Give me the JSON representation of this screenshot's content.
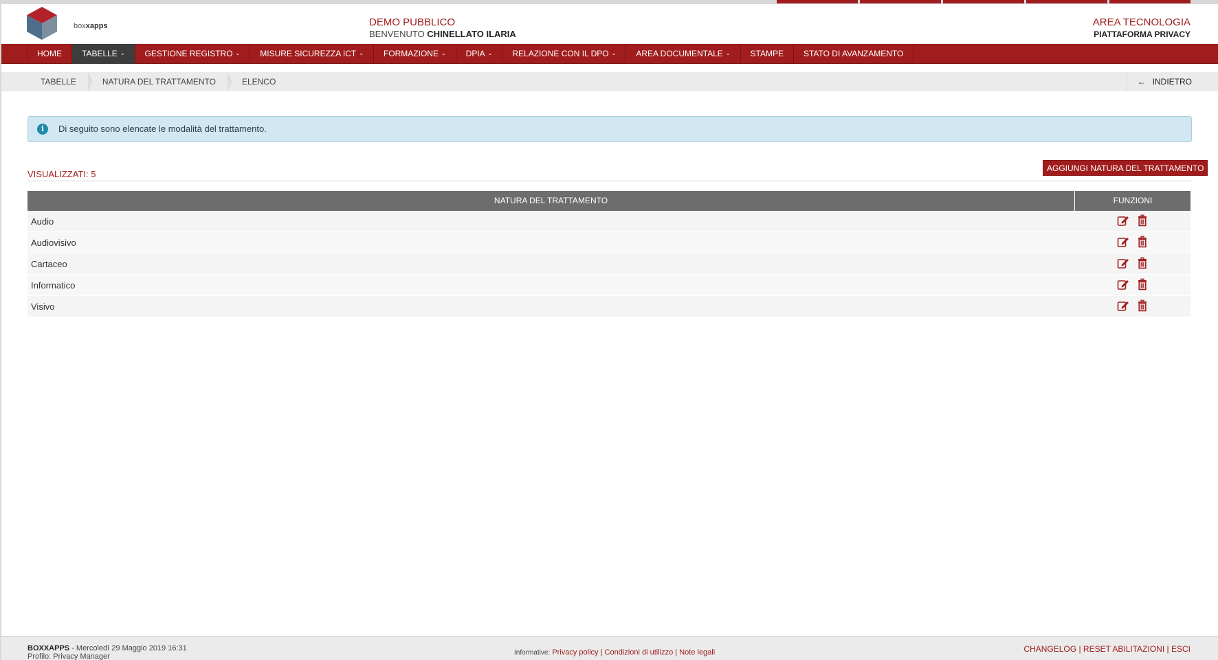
{
  "brand": {
    "logo_text_left": "box",
    "logo_text_right": "xapps"
  },
  "header": {
    "demo_title": "DEMO PUBBLICO",
    "welcome_prefix": "BENVENUTO",
    "welcome_user": "CHINELLATO ILARIA",
    "area_title": "AREA TECNOLOGIA",
    "area_subtitle": "PIATTAFORMA PRIVACY"
  },
  "nav": {
    "items": [
      {
        "label": "HOME",
        "dropdown": false
      },
      {
        "label": "TABELLE",
        "dropdown": true,
        "active": true
      },
      {
        "label": "GESTIONE REGISTRO",
        "dropdown": true
      },
      {
        "label": "MISURE SICUREZZA ICT",
        "dropdown": true
      },
      {
        "label": "FORMAZIONE",
        "dropdown": true
      },
      {
        "label": "DPIA",
        "dropdown": true
      },
      {
        "label": "RELAZIONE CON IL DPO",
        "dropdown": true
      },
      {
        "label": "AREA DOCUMENTALE",
        "dropdown": true
      },
      {
        "label": "STAMPE",
        "dropdown": false
      },
      {
        "label": "STATO DI AVANZAMENTO",
        "dropdown": false
      }
    ],
    "chevron": "⌄"
  },
  "breadcrumb": {
    "items": [
      "TABELLE",
      "NATURA DEL TRATTAMENTO",
      "ELENCO"
    ],
    "back_label": "INDIETRO",
    "back_icon": "arrow-left-icon"
  },
  "info": {
    "text": "Di seguito sono elencate le modalità del trattamento.",
    "icon": "info-icon"
  },
  "list": {
    "count_label": "VISUALIZZATI: 5",
    "add_button": "AGGIUNGI NATURA DEL TRATTAMENTO",
    "columns": [
      "NATURA DEL TRATTAMENTO",
      "FUNZIONI"
    ],
    "rows": [
      "Audio",
      "Audiovisivo",
      "Cartaceo",
      "Informatico",
      "Visivo"
    ]
  },
  "footer": {
    "company": "BOXXAPPS",
    "datetime": " - Mercoledì 29 Maggio 2019 16:31",
    "profile": "Profilo: Privacy Manager",
    "info_label": "Informative:",
    "links": [
      "Privacy policy",
      "Condizioni di utilizzo",
      "Note legali"
    ],
    "right_links": [
      "CHANGELOG",
      "RESET ABILITAZIONI",
      "ESCI"
    ]
  },
  "colors": {
    "brand_red": "#a11d1d",
    "active_nav": "#3d3d3d",
    "info_bg": "#d1e7f1"
  }
}
